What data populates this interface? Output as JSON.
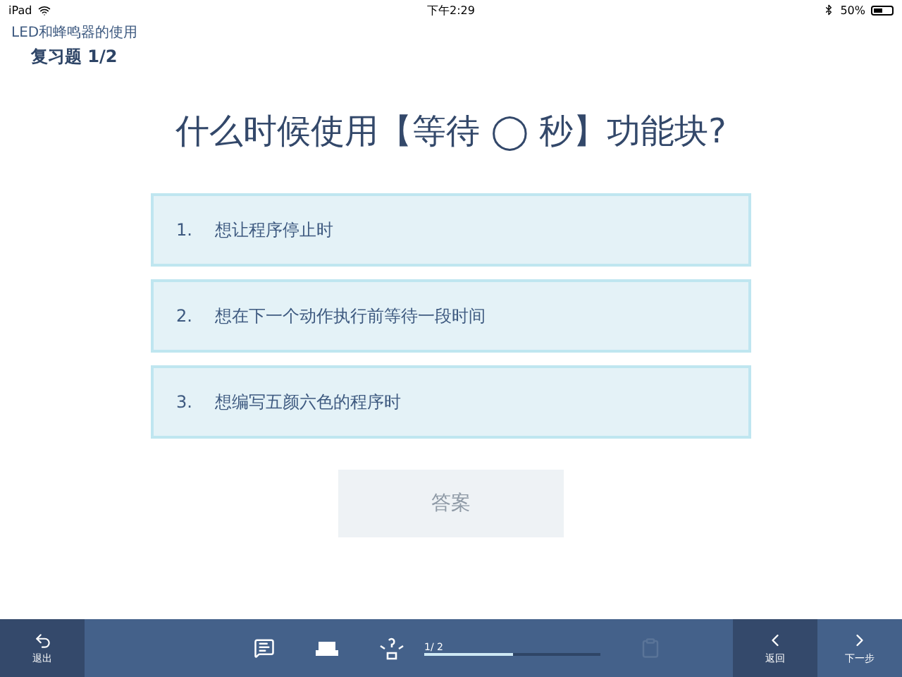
{
  "status_bar": {
    "device": "iPad",
    "time": "下午2:29",
    "battery": "50%"
  },
  "header": {
    "lesson": "LED和蜂鸣器的使用",
    "subtitle": "复习题 1/2"
  },
  "question": "什么时候使用【等待 ◯ 秒】功能块?",
  "options": [
    {
      "number": "1.",
      "text": "想让程序停止时",
      "selected": false
    },
    {
      "number": "2.",
      "text": "想在下一个动作执行前等待一段时间",
      "selected": false
    },
    {
      "number": "3.",
      "text": "想编写五颜六色的程序时",
      "selected": false
    }
  ],
  "answer_button": {
    "label": "答案",
    "disabled": true
  },
  "bottom_bar": {
    "exit": "退出",
    "progress": {
      "label": "1/ 2",
      "level": 0.5
    },
    "notes_disabled": true,
    "back": "返回",
    "next": "下一步"
  }
}
